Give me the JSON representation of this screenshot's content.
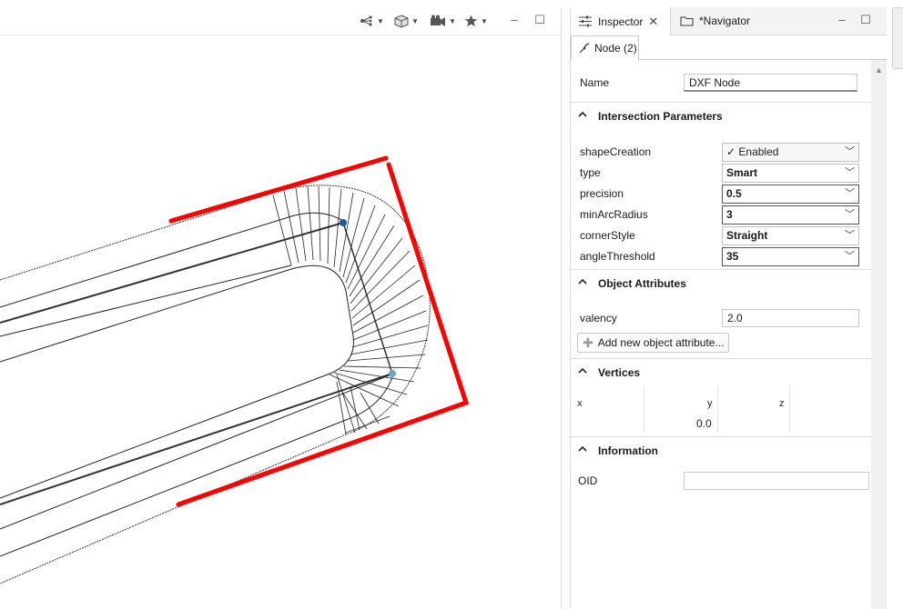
{
  "viewport": {
    "toolbar": {
      "icons": [
        "share-network-icon",
        "cube-icon",
        "camera-icon",
        "star-icon"
      ],
      "minimize": "–",
      "maximize": "☐"
    }
  },
  "inspector": {
    "tabs": [
      {
        "label": "Inspector",
        "icon": "sliders-icon",
        "close": "✕"
      },
      {
        "label": "*Navigator",
        "icon": "folder-icon"
      }
    ],
    "minimize": "–",
    "maximize": "☐",
    "subtab": {
      "label": "Node (2)",
      "icon": "node-icon"
    },
    "name": {
      "label": "Name",
      "value": "DXF Node"
    },
    "sections": {
      "intersection": "Intersection Parameters",
      "object_attributes": "Object Attributes",
      "vertices": "Vertices",
      "information": "Information"
    },
    "params": [
      {
        "label": "shapeCreation",
        "value": "✓ Enabled"
      },
      {
        "label": "type",
        "value": "Smart"
      },
      {
        "label": "precision",
        "value": "0.5"
      },
      {
        "label": "minArcRadius",
        "value": "3"
      },
      {
        "label": "cornerStyle",
        "value": "Straight"
      },
      {
        "label": "angleThreshold",
        "value": "35"
      }
    ],
    "attributes": [
      {
        "label": "valency",
        "value": "2.0"
      }
    ],
    "add_attribute_label": "Add new object attribute...",
    "vertices": {
      "columns": [
        "x",
        "y",
        "z"
      ],
      "row": [
        "",
        "0.0",
        ""
      ]
    },
    "information": {
      "label": "OID",
      "value": ""
    }
  },
  "colors": {
    "accent_red": "#ff0000",
    "vertex_blue": "#2060a0"
  }
}
